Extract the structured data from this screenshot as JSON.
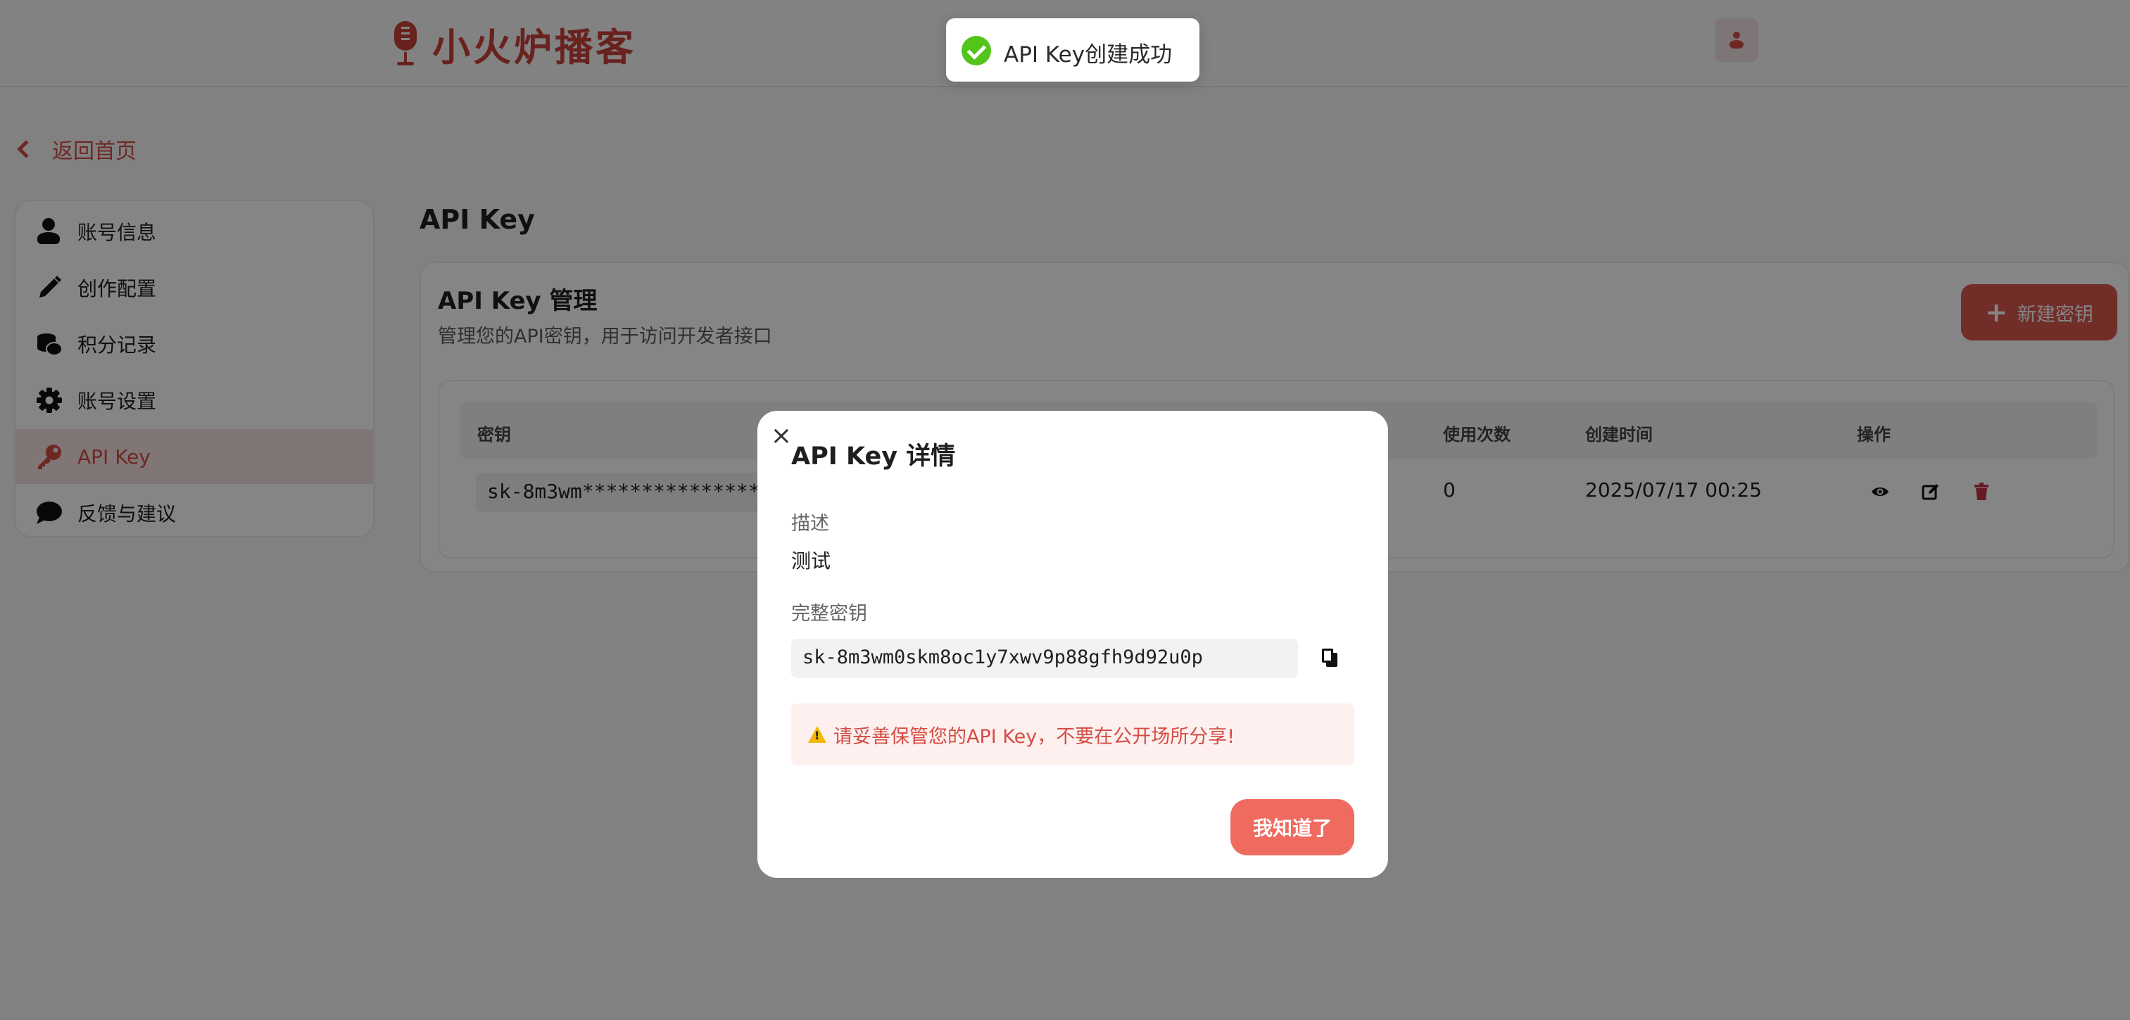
{
  "header": {
    "logo_text": "小火炉播客"
  },
  "nav": {
    "back_label": "返回首页"
  },
  "sidebar": {
    "items": [
      {
        "label": "账号信息",
        "icon": "user-icon"
      },
      {
        "label": "创作配置",
        "icon": "pencil-icon"
      },
      {
        "label": "积分记录",
        "icon": "coins-icon"
      },
      {
        "label": "账号设置",
        "icon": "gear-icon"
      },
      {
        "label": "API Key",
        "icon": "key-icon",
        "active": true
      },
      {
        "label": "反馈与建议",
        "icon": "comment-icon"
      }
    ]
  },
  "page": {
    "title": "API Key"
  },
  "card": {
    "title": "API Key 管理",
    "subtitle": "管理您的API密钥，用于访问开发者接口",
    "new_button_label": "新建密钥",
    "table": {
      "headers": {
        "key": "密钥",
        "usage": "使用次数",
        "created": "创建时间",
        "actions": "操作"
      },
      "rows": [
        {
          "key": "sk-8m3wm****************",
          "usage": "0",
          "created": "2025/07/17 00:25"
        }
      ]
    }
  },
  "toast": {
    "message": "API Key创建成功",
    "type": "success"
  },
  "modal": {
    "title": "API Key 详情",
    "close_symbol": "×",
    "desc_label": "描述",
    "desc_value": "测试",
    "full_key_label": "完整密钥",
    "full_key_value": "sk-8m3wm0skm8oc1y7xwv9p88gfh9d92u0p",
    "warning": "请妥善保管您的API Key，不要在公开场所分享!",
    "confirm_label": "我知道了"
  },
  "colors": {
    "brand": "#c9413a",
    "accent": "#d9584e",
    "success": "#52c41a",
    "danger": "#c23347"
  }
}
